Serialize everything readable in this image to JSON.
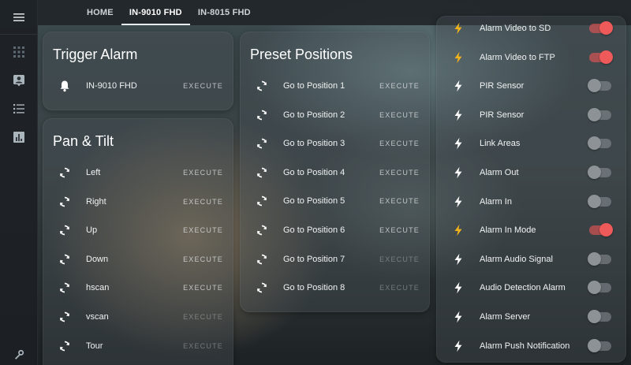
{
  "colors": {
    "accent_on": "#ee5a5a",
    "bolt_active": "#f2b21b",
    "bolt_inactive": "#ffffff"
  },
  "sidebar": {
    "menu_icon": "hamburger-menu-icon",
    "items": [
      {
        "icon": "grid-icon",
        "label": ""
      },
      {
        "icon": "person-card-icon",
        "label": ""
      },
      {
        "icon": "list-icon",
        "label": ""
      },
      {
        "icon": "chart-icon",
        "label": ""
      }
    ],
    "bottom_icon": "wrench-icon"
  },
  "tabs": [
    {
      "label": "HOME",
      "active": false
    },
    {
      "label": "IN-9010 FHD",
      "active": true
    },
    {
      "label": "IN-8015 FHD",
      "active": false
    }
  ],
  "trigger_alarm": {
    "title": "Trigger Alarm",
    "rows": [
      {
        "label": "IN-9010 FHD",
        "action": "EXECUTE",
        "icon": "bell-icon"
      }
    ]
  },
  "pan_tilt": {
    "title": "Pan & Tilt",
    "rows": [
      {
        "label": "Left",
        "action": "EXECUTE",
        "icon": "refresh-icon",
        "dim": false
      },
      {
        "label": "Right",
        "action": "EXECUTE",
        "icon": "refresh-icon",
        "dim": false
      },
      {
        "label": "Up",
        "action": "EXECUTE",
        "icon": "refresh-icon",
        "dim": false
      },
      {
        "label": "Down",
        "action": "EXECUTE",
        "icon": "refresh-icon",
        "dim": false
      },
      {
        "label": "hscan",
        "action": "EXECUTE",
        "icon": "refresh-icon",
        "dim": false
      },
      {
        "label": "vscan",
        "action": "EXECUTE",
        "icon": "refresh-icon",
        "dim": true
      },
      {
        "label": "Tour",
        "action": "EXECUTE",
        "icon": "refresh-icon",
        "dim": true
      }
    ]
  },
  "preset_positions": {
    "title": "Preset Positions",
    "rows": [
      {
        "label": "Go to Position 1",
        "action": "EXECUTE",
        "icon": "refresh-icon",
        "dim": false
      },
      {
        "label": "Go to Position 2",
        "action": "EXECUTE",
        "icon": "refresh-icon",
        "dim": false
      },
      {
        "label": "Go to Position 3",
        "action": "EXECUTE",
        "icon": "refresh-icon",
        "dim": false
      },
      {
        "label": "Go to Position 4",
        "action": "EXECUTE",
        "icon": "refresh-icon",
        "dim": false
      },
      {
        "label": "Go to Position 5",
        "action": "EXECUTE",
        "icon": "refresh-icon",
        "dim": false
      },
      {
        "label": "Go to Position 6",
        "action": "EXECUTE",
        "icon": "refresh-icon",
        "dim": false
      },
      {
        "label": "Go to Position 7",
        "action": "EXECUTE",
        "icon": "refresh-icon",
        "dim": true
      },
      {
        "label": "Go to Position 8",
        "action": "EXECUTE",
        "icon": "refresh-icon",
        "dim": true
      }
    ]
  },
  "alarm_switches": {
    "rows": [
      {
        "label": "Alarm Video to SD",
        "on": true
      },
      {
        "label": "Alarm Video to FTP",
        "on": true
      },
      {
        "label": "PIR Sensor",
        "on": false
      },
      {
        "label": "PIR Sensor",
        "on": false
      },
      {
        "label": "Link Areas",
        "on": false
      },
      {
        "label": "Alarm Out",
        "on": false
      },
      {
        "label": "Alarm In",
        "on": false
      },
      {
        "label": "Alarm In Mode",
        "on": true
      },
      {
        "label": "Alarm Audio Signal",
        "on": false
      },
      {
        "label": "Audio Detection Alarm",
        "on": false
      },
      {
        "label": "Alarm Server",
        "on": false
      },
      {
        "label": "Alarm Push Notification",
        "on": false
      }
    ]
  }
}
